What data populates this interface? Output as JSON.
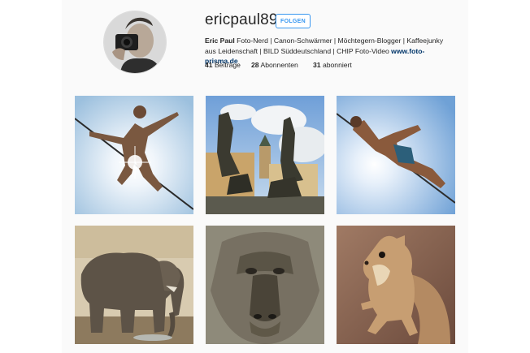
{
  "profile": {
    "username": "ericpaul89",
    "follow_label": "FOLGEN",
    "full_name": "Eric Paul",
    "bio_text": "Foto-Nerd | Canon-Schwärmer | Möchtegern-Blogger | Kaffeejunky aus Leidenschaft | BILD Süddeutschland | CHIP Foto-Video",
    "website": "www.foto-prisma.de"
  },
  "stats": {
    "posts_count": "41",
    "posts_label": "Beiträge",
    "followers_count": "28",
    "followers_label": "Abonnenten",
    "following_count": "31",
    "following_label": "abonniert"
  },
  "colors": {
    "accent": "#3897f0",
    "link": "#003569",
    "text": "#262626",
    "panel_bg": "#fafafa"
  },
  "posts": [
    {
      "subject": "slackliner-sunburst"
    },
    {
      "subject": "fountain-statues"
    },
    {
      "subject": "slackliner-blue-sky"
    },
    {
      "subject": "elephant"
    },
    {
      "subject": "baboon"
    },
    {
      "subject": "squirrel"
    }
  ]
}
